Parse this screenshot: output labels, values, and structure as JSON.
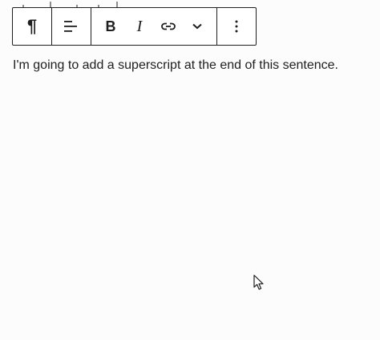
{
  "toolbar": {
    "buttons": [
      {
        "name": "paragraph-block-button",
        "icon": "pilcrow-icon"
      },
      {
        "name": "align-button",
        "icon": "align-left-icon"
      },
      {
        "name": "bold-button",
        "icon": "bold-icon",
        "label": "B"
      },
      {
        "name": "italic-button",
        "icon": "italic-icon",
        "label": "I"
      },
      {
        "name": "link-button",
        "icon": "link-icon"
      },
      {
        "name": "more-formatting-button",
        "icon": "chevron-down-icon"
      },
      {
        "name": "options-button",
        "icon": "vertical-ellipsis-icon"
      }
    ],
    "pilcrow_glyph": "¶"
  },
  "content": {
    "paragraph": "I'm going to add a superscript at the end of this sentence."
  },
  "colors": {
    "background": "#fcfcfd",
    "text": "#1e1e1e",
    "toolbar_border": "#1e1e1e"
  }
}
